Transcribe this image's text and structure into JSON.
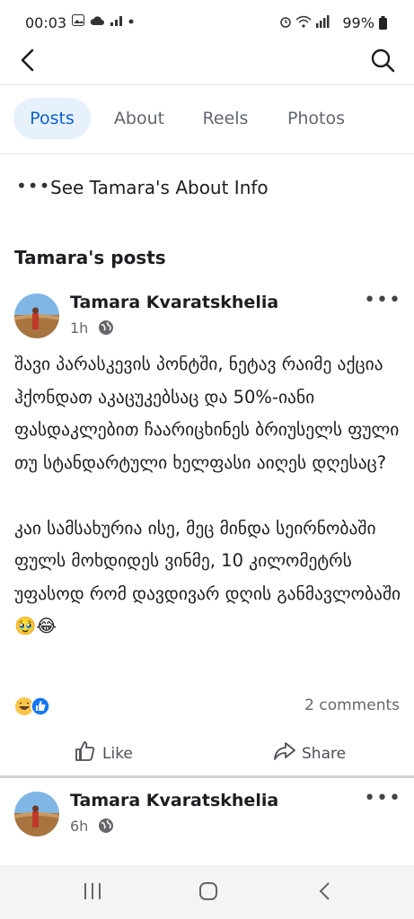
{
  "status_bar": {
    "time": "00:03",
    "notification_icons": [
      "gallery-icon",
      "cloud-icon",
      "signal-icon",
      "dot-icon"
    ],
    "battery": "99%",
    "system_icons": [
      "alarm-icon",
      "wifi-icon",
      "signal-bars-icon",
      "battery-icon"
    ]
  },
  "top_bar": {
    "back_icon": "back-arrow-icon",
    "search_icon": "search-icon"
  },
  "tabs": [
    {
      "label": "Posts",
      "active": true
    },
    {
      "label": "About",
      "active": false
    },
    {
      "label": "Reels",
      "active": false
    },
    {
      "label": "Photos",
      "active": false
    }
  ],
  "about_row": {
    "label": "See Tamara's About Info"
  },
  "section_title": "Tamara's posts",
  "posts": [
    {
      "author": "Tamara Kvaratskhelia",
      "time": "1h",
      "text": "შავი პარასკევის პონტში, ნეტავ რაიმე აქცია ჰქონდათ აკაცუკებსაც და 50%-იანი ფასდაკლებით ჩაარიცხინეს ბრიუსელს ფული თუ სტანდარტული ხელფასი აიღეს დღესაც?\n\nკაი სამსახურია ისე, მეც მინდა სეირნობაში ფულს მოხდიდეს ვინმე, 10 კილომეტრს უფასოდ რომ დავდივარ დღის განმავლობაში 🥹😂",
      "reactions": [
        "haha",
        "like"
      ],
      "comments": "2 comments",
      "like_label": "Like",
      "share_label": "Share"
    },
    {
      "author": "Tamara Kvaratskhelia",
      "time": "6h"
    }
  ],
  "colors": {
    "accent": "#0a63c9",
    "active_tab_bg": "#e7f1fd",
    "secondary_text": "#65676b"
  }
}
